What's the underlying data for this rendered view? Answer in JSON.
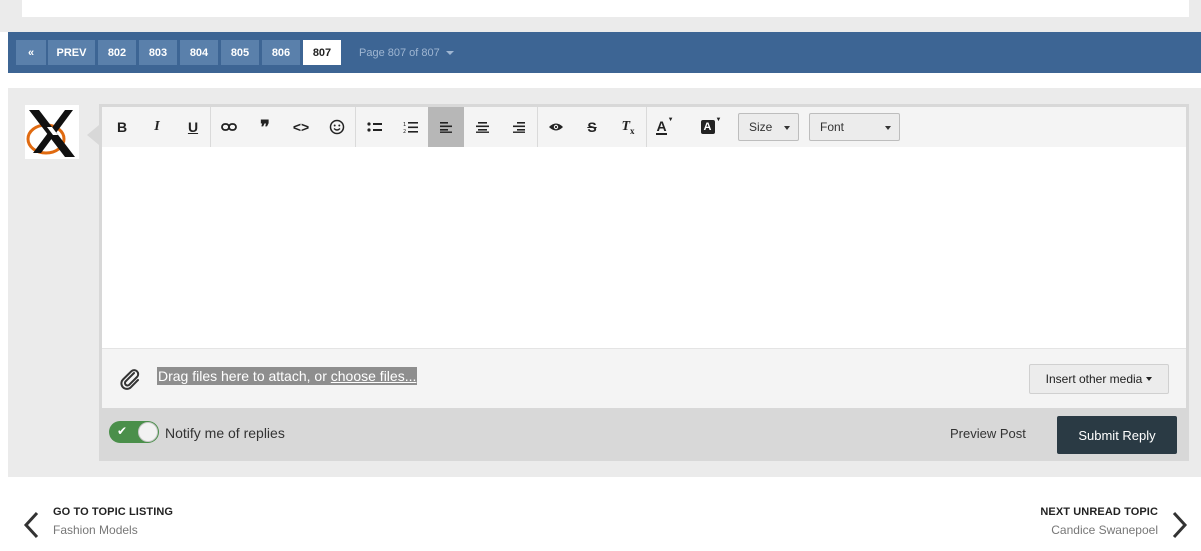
{
  "pagination": {
    "first_label": "«",
    "prev_label": "PREV",
    "pages": [
      "802",
      "803",
      "804",
      "805",
      "806",
      "807"
    ],
    "active_page": "807",
    "page_info": "Page 807 of 807"
  },
  "editor": {
    "toolbar": {
      "bold": "B",
      "italic": "I",
      "underline": "U",
      "size_label": "Size",
      "font_label": "Font"
    },
    "attach": {
      "text": "Drag files here to attach, or ",
      "link": "choose files..."
    },
    "insert_media_label": "Insert other media"
  },
  "reply": {
    "notify_label": "Notify me of replies",
    "notify_on": true,
    "preview_label": "Preview Post",
    "submit_label": "Submit Reply"
  },
  "navigation": {
    "prev_title": "GO TO TOPIC LISTING",
    "prev_sub": "Fashion Models",
    "next_title": "NEXT UNREAD TOPIC",
    "next_sub": "Candice Swanepoel"
  },
  "colors": {
    "pagebar": "#3d6594",
    "submit": "#2a3a44",
    "toggle_on": "#4a8f4a"
  }
}
